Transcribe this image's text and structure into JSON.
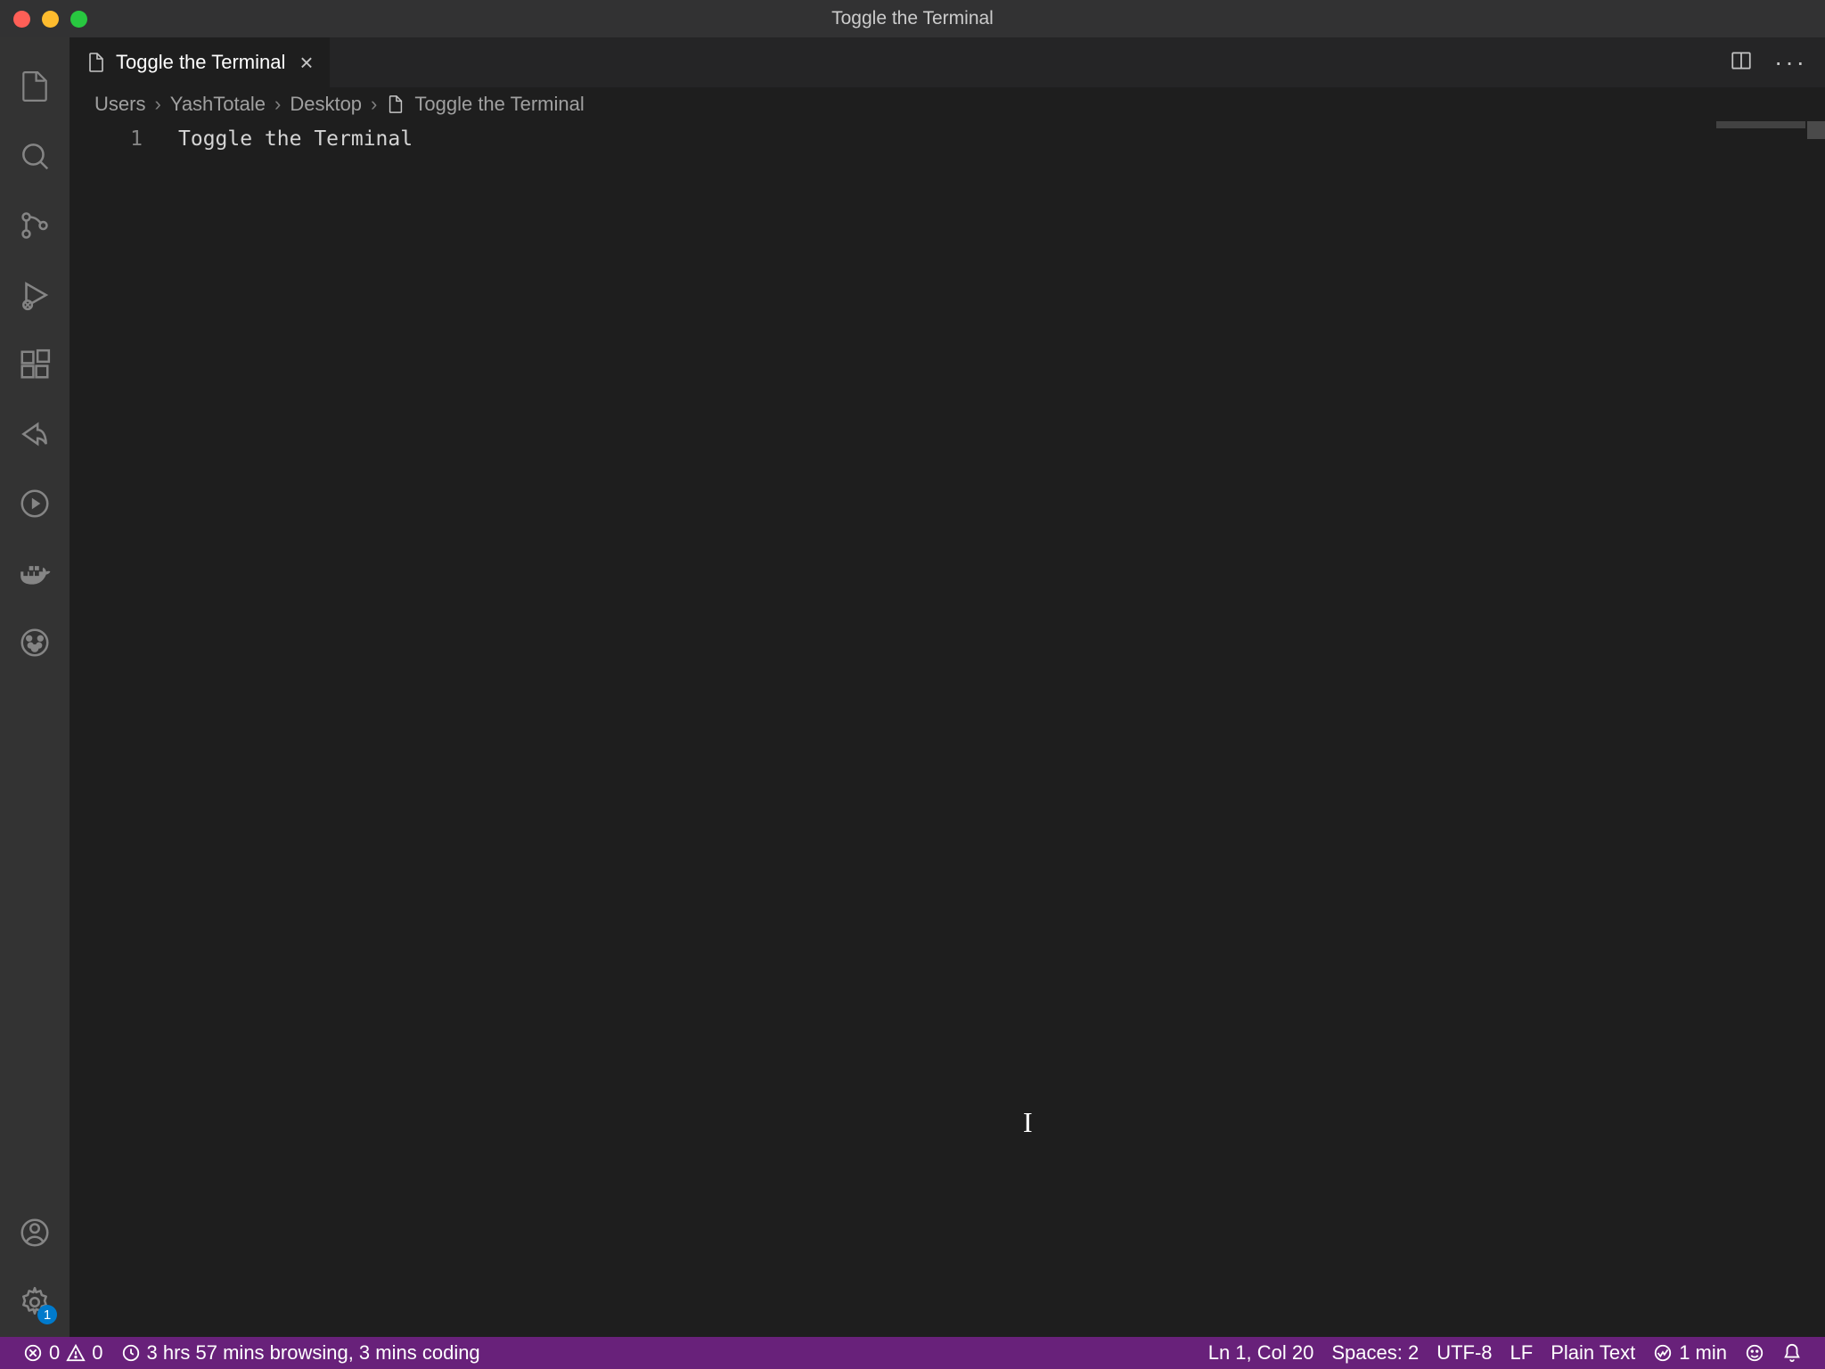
{
  "window": {
    "title": "Toggle the Terminal"
  },
  "tab": {
    "label": "Toggle the Terminal"
  },
  "breadcrumb": {
    "parts": [
      "Users",
      "YashTotale",
      "Desktop",
      "Toggle the Terminal"
    ]
  },
  "editor": {
    "line_number": "1",
    "content": "Toggle the Terminal"
  },
  "statusbar": {
    "errors": "0",
    "warnings": "0",
    "time_tracking": "3 hrs 57 mins browsing, 3 mins coding",
    "cursor_pos": "Ln 1, Col 20",
    "spaces": "Spaces: 2",
    "encoding": "UTF-8",
    "eol": "LF",
    "language": "Plain Text",
    "wakatime": "1 min"
  },
  "settings_badge": "1"
}
